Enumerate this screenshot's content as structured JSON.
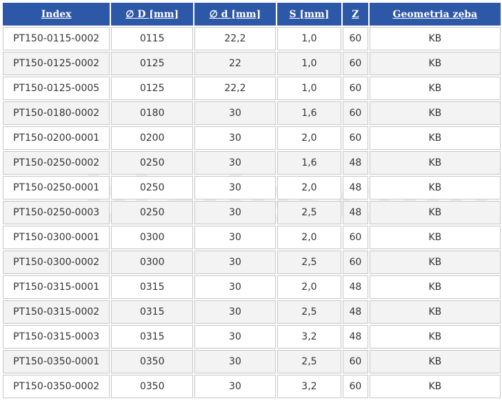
{
  "table": {
    "headers": [
      "Index",
      "∅ D [mm]",
      "∅ d [mm]",
      "S [mm]",
      "Z",
      "Geometria zęba"
    ],
    "rows": [
      [
        "PT150-0115-0002",
        "0115",
        "22,2",
        "1,0",
        "60",
        "KB"
      ],
      [
        "PT150-0125-0002",
        "0125",
        "22",
        "1,0",
        "60",
        "KB"
      ],
      [
        "PT150-0125-0005",
        "0125",
        "22,2",
        "1,0",
        "60",
        "KB"
      ],
      [
        "PT150-0180-0002",
        "0180",
        "30",
        "1,6",
        "60",
        "KB"
      ],
      [
        "PT150-0200-0001",
        "0200",
        "30",
        "2,0",
        "60",
        "KB"
      ],
      [
        "PT150-0250-0002",
        "0250",
        "30",
        "1,6",
        "48",
        "KB"
      ],
      [
        "PT150-0250-0001",
        "0250",
        "30",
        "2,0",
        "48",
        "KB"
      ],
      [
        "PT150-0250-0003",
        "0250",
        "30",
        "2,5",
        "48",
        "KB"
      ],
      [
        "PT150-0300-0001",
        "0300",
        "30",
        "2,0",
        "60",
        "KB"
      ],
      [
        "PT150-0300-0002",
        "0300",
        "30",
        "2,5",
        "60",
        "KB"
      ],
      [
        "PT150-0315-0001",
        "0315",
        "30",
        "2,0",
        "48",
        "KB"
      ],
      [
        "PT150-0315-0002",
        "0315",
        "30",
        "2,5",
        "48",
        "KB"
      ],
      [
        "PT150-0315-0003",
        "0315",
        "30",
        "3,2",
        "48",
        "KB"
      ],
      [
        "PT150-0350-0001",
        "0350",
        "30",
        "2,5",
        "60",
        "KB"
      ],
      [
        "PT150-0350-0002",
        "0350",
        "30",
        "3,2",
        "60",
        "KB"
      ]
    ]
  },
  "watermark": "bladescenter",
  "colors": {
    "header_bg": "#2d57a7",
    "header_text": "#ffffff",
    "row_alt_bg": "#f3f3f3",
    "cell_border": "#c6c6c6"
  }
}
